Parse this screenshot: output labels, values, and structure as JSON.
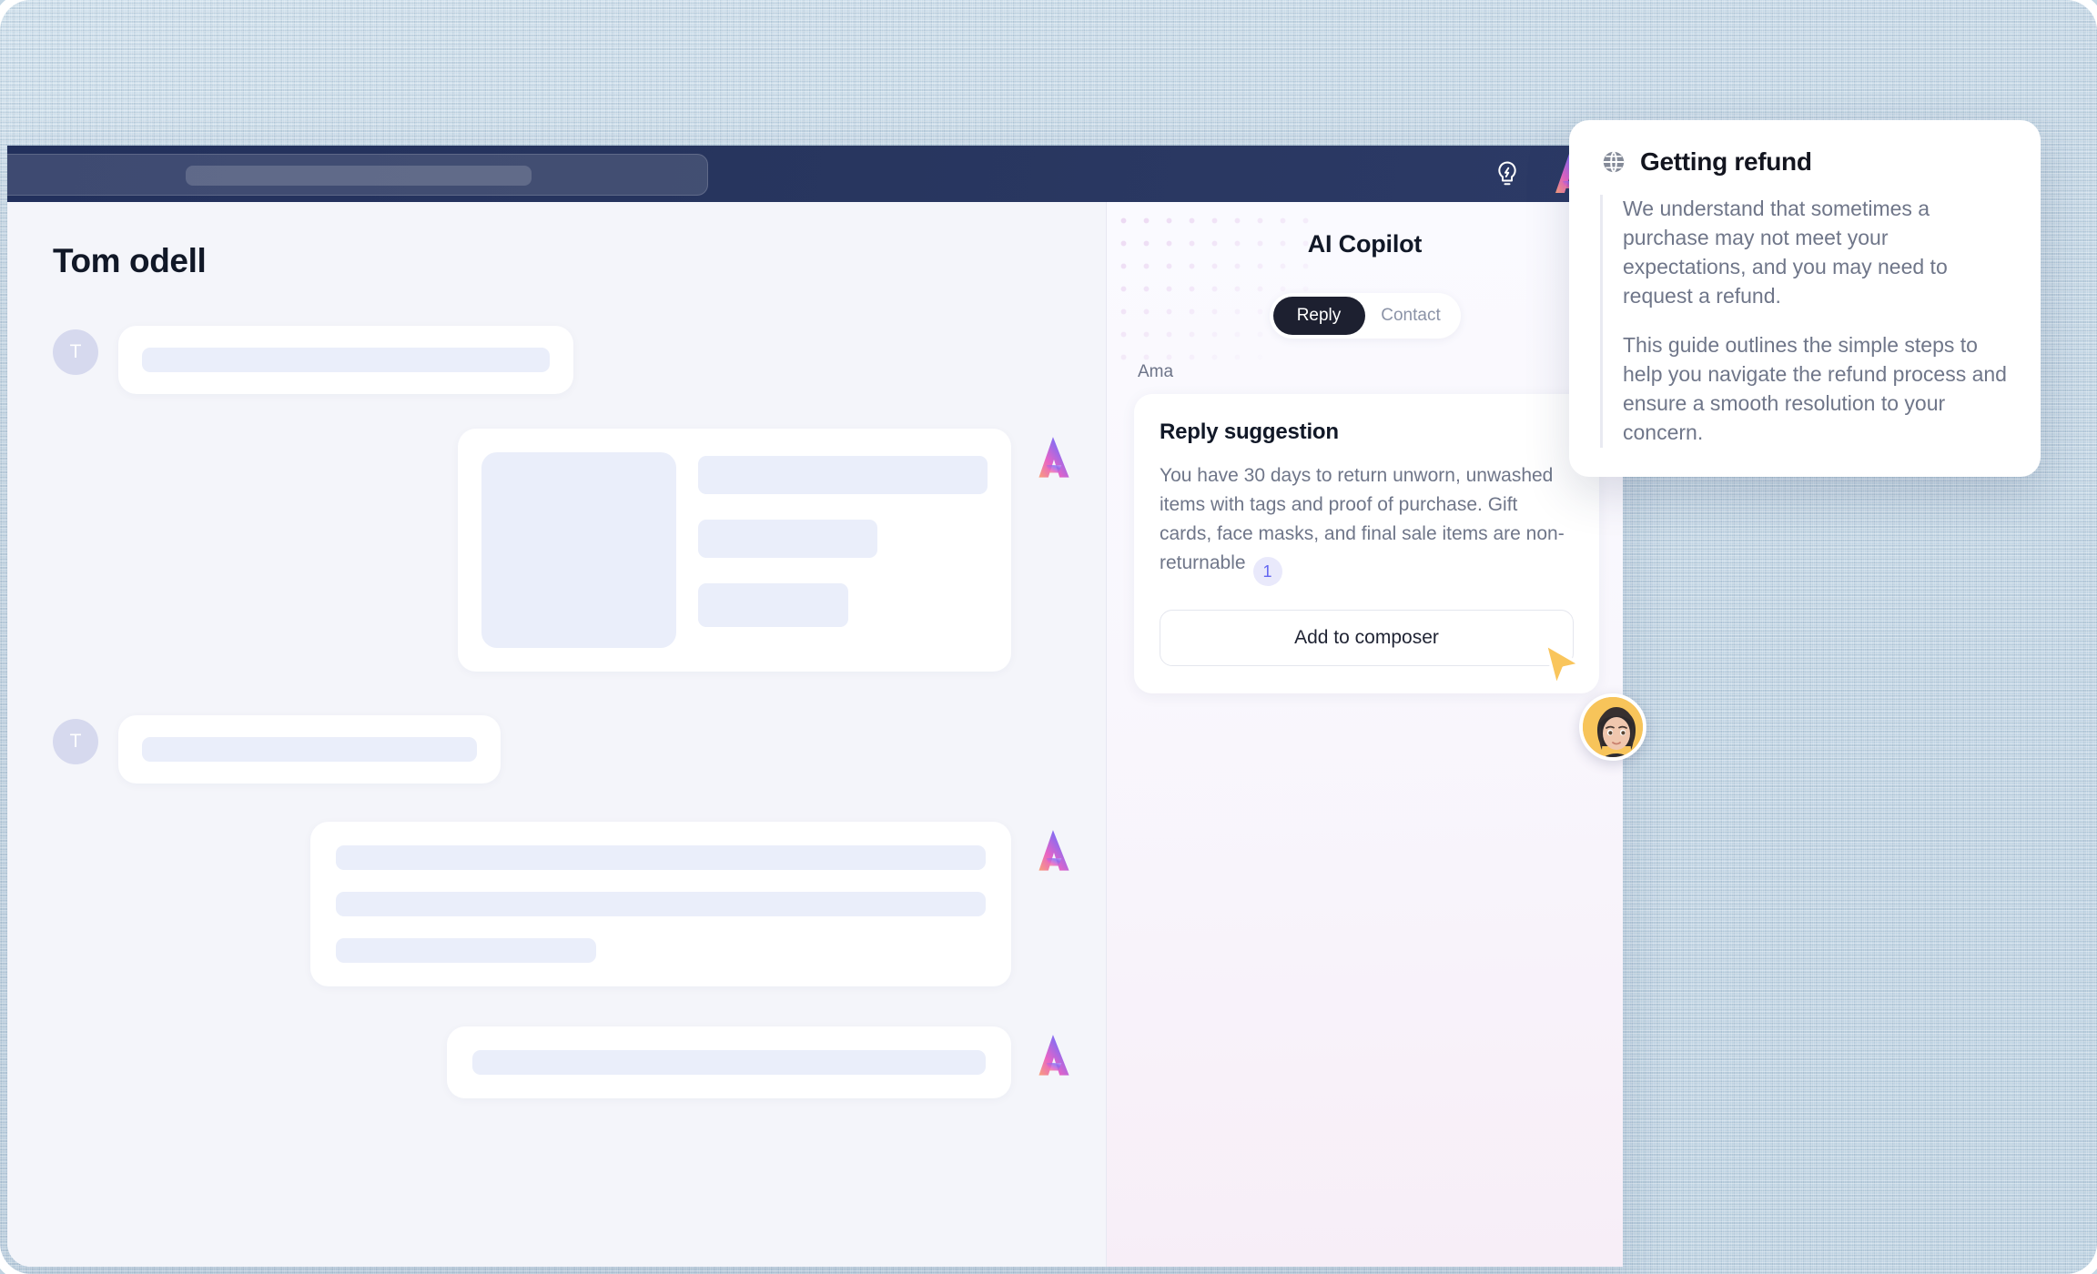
{
  "navbar": {
    "search_placeholder": "",
    "bulb_icon": "lightbulb-bolt-icon",
    "logo_icon": "brand-a-logo"
  },
  "conversation": {
    "title": "Tom odell",
    "avatar_initial": "T",
    "messages": [
      {
        "id": "msg1",
        "direction": "inbound",
        "type": "text"
      },
      {
        "id": "msg2",
        "direction": "outbound",
        "type": "image-and-text"
      },
      {
        "id": "msg3",
        "direction": "inbound",
        "type": "text"
      },
      {
        "id": "msg4",
        "direction": "outbound",
        "type": "text"
      },
      {
        "id": "msg5",
        "direction": "outbound",
        "type": "text"
      }
    ]
  },
  "copilot": {
    "title": "AI Copilot",
    "close_icon": "close-icon",
    "tabs": [
      {
        "label": "Reply",
        "active": true
      },
      {
        "label": "Contact",
        "active": false
      }
    ],
    "sender": "Ama",
    "suggestion": {
      "heading": "Reply suggestion",
      "body": "You have 30 days to return unworn, unwashed items with tags and proof of purchase. Gift cards, face masks, and final sale items are non-returnable",
      "citation": "1",
      "action_label": "Add to composer"
    }
  },
  "knowledge_card": {
    "icon": "globe-icon",
    "title": "Getting refund",
    "paragraphs": [
      "We understand that sometimes a purchase may not meet your expectations, and you may need to request a refund.",
      "This guide outlines the simple steps to help you navigate the refund process and ensure a smooth resolution to your concern."
    ]
  },
  "overlay": {
    "cursor_icon": "cursor-pointer-icon",
    "presence_avatar": "user-avatar"
  },
  "colors": {
    "navbar": "#22305c",
    "accent_dark": "#1d2030",
    "citation_text": "#6366f1",
    "cursor": "#f7c45a",
    "background": "#c7dae7"
  }
}
